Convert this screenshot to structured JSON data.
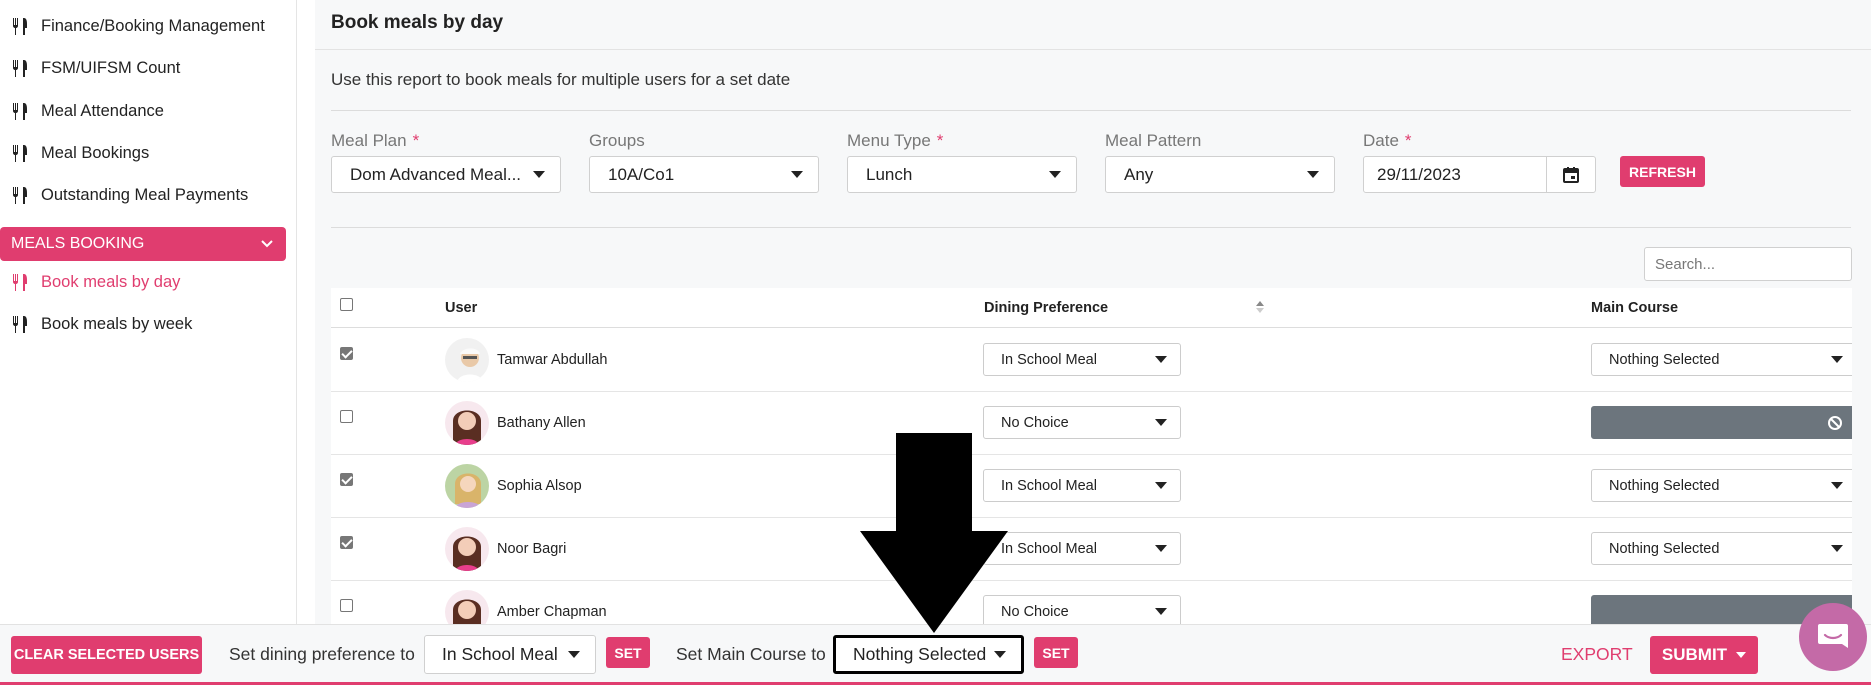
{
  "sidebar": {
    "items": [
      {
        "label": "Finance/Booking Management"
      },
      {
        "label": "FSM/UIFSM Count"
      },
      {
        "label": "Meal Attendance"
      },
      {
        "label": "Meal Bookings"
      },
      {
        "label": "Outstanding Meal Payments"
      }
    ],
    "section_label": "MEALS BOOKING",
    "sub_items": [
      {
        "label": "Book meals by day",
        "active": true
      },
      {
        "label": "Book meals by week",
        "active": false
      }
    ]
  },
  "page": {
    "title": "Book meals by day",
    "description": "Use this report to book meals for multiple users for a set date"
  },
  "filters": {
    "meal_plan": {
      "label": "Meal Plan",
      "required": "*",
      "value": "Dom Advanced Meal..."
    },
    "groups": {
      "label": "Groups",
      "value": "10A/Co1"
    },
    "menu_type": {
      "label": "Menu Type",
      "required": "*",
      "value": "Lunch"
    },
    "meal_pattern": {
      "label": "Meal Pattern",
      "value": "Any"
    },
    "date": {
      "label": "Date",
      "required": "*",
      "value": "29/11/2023"
    },
    "refresh_label": "REFRESH"
  },
  "search": {
    "placeholder": "Search..."
  },
  "table": {
    "headers": {
      "user": "User",
      "dining": "Dining Preference",
      "main": "Main Course"
    },
    "rows": [
      {
        "name": "Tamwar Abdullah",
        "checked": true,
        "dining": "In School Meal",
        "main": "Nothing Selected",
        "main_disabled": false
      },
      {
        "name": "Bathany Allen",
        "checked": false,
        "dining": "No Choice",
        "main": "",
        "main_disabled": true
      },
      {
        "name": "Sophia Alsop",
        "checked": true,
        "dining": "In School Meal",
        "main": "Nothing Selected",
        "main_disabled": false
      },
      {
        "name": "Noor Bagri",
        "checked": true,
        "dining": "In School Meal",
        "main": "Nothing Selected",
        "main_disabled": false
      },
      {
        "name": "Amber Chapman",
        "checked": false,
        "dining": "No Choice",
        "main": "",
        "main_disabled": true
      }
    ]
  },
  "bottom_bar": {
    "clear_label": "CLEAR SELECTED USERS",
    "dining_text": "Set dining preference to",
    "dining_value": "In School Meal",
    "set_label": "SET",
    "main_text": "Set Main Course to",
    "main_value": "Nothing Selected",
    "export_label": "EXPORT",
    "submit_label": "SUBMIT"
  },
  "colors": {
    "accent": "#e03d6f",
    "disabled": "#6c757d",
    "chat": "#c46aa7"
  },
  "icons": [
    "fork-knife-icon",
    "chevron-down-icon",
    "calendar-icon",
    "sort-icon",
    "ban-icon",
    "chat-icon",
    "down-arrow-annotation"
  ]
}
